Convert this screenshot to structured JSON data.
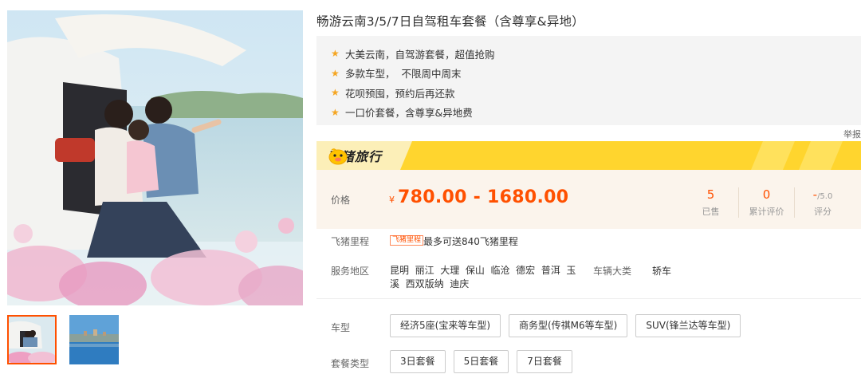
{
  "title": "畅游云南3/5/7日自驾租车套餐（含尊享&异地）",
  "features": [
    "大美云南，自驾游套餐，超值抢购",
    "多款车型，  不限周中周末",
    "花呗预囤，预约后再还款",
    "一口价套餐，含尊享&异地费"
  ],
  "report_label": "举报",
  "brand": {
    "name": "飞猪旅行",
    "logo_icon": "fliggy-pig-icon",
    "accent": "#ffd52e"
  },
  "price": {
    "label": "价格",
    "currency": "¥",
    "value": "780.00 - 1680.00",
    "color": "#ff5000"
  },
  "stats": [
    {
      "value": "5",
      "suffix": "",
      "label": "已售"
    },
    {
      "value": "0",
      "suffix": "",
      "label": "累计评价"
    },
    {
      "value": "-",
      "suffix": "/5.0",
      "label": "评分"
    }
  ],
  "miles": {
    "label": "飞猪里程",
    "tag": "飞猪里程",
    "text": "最多可送840飞猪里程"
  },
  "service_area": {
    "label": "服务地区",
    "cities": [
      "昆明",
      "丽江",
      "大理",
      "保山",
      "临沧",
      "德宏",
      "普洱",
      "玉溪",
      "西双版纳",
      "迪庆"
    ],
    "line1": "昆明  丽江  大理  保山  临沧  德宏  普洱  玉",
    "line2": "溪  西双版纳  迪庆"
  },
  "vehicle_category": {
    "label": "车辆大类",
    "value": "轿车"
  },
  "car_models": {
    "label": "车型",
    "options": [
      "经济5座(宝来等车型)",
      "商务型(传祺M6等车型)",
      "SUV(锋兰达等车型)"
    ]
  },
  "packages": {
    "label": "套餐类型",
    "options": [
      "3日套餐",
      "5日套餐",
      "7日套餐"
    ]
  }
}
